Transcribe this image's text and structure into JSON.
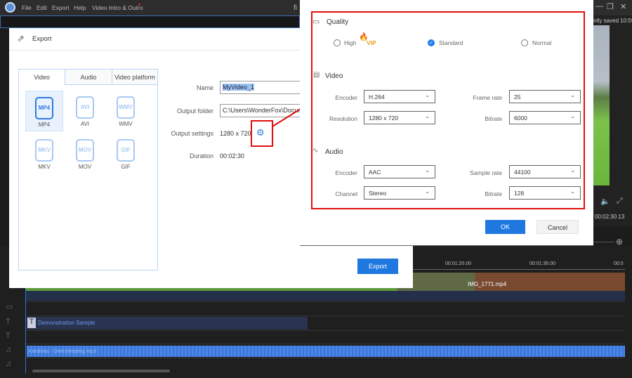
{
  "menu": {
    "items": [
      "File",
      "Edit",
      "Export",
      "Help",
      "Video Intro & Outro"
    ],
    "title_partial": "fi"
  },
  "status": {
    "saved": "ntly saved 10:59",
    "timecode": "00:02:30.13"
  },
  "export": {
    "title": "Export",
    "tabs": [
      "Video",
      "Audio",
      "Video platform"
    ],
    "formats": [
      {
        "icon": "MP4",
        "label": "MP4"
      },
      {
        "icon": "AVI",
        "label": "AVI"
      },
      {
        "icon": "WMV",
        "label": "WMV"
      },
      {
        "icon": "MKV",
        "label": "MKV"
      },
      {
        "icon": "MOV",
        "label": "MOV"
      },
      {
        "icon": "GIF",
        "label": "GIF"
      }
    ],
    "name_label": "Name",
    "name_value": "MyVideo_1",
    "folder_label": "Output folder",
    "folder_value": "C:\\Users\\WonderFox\\Docum",
    "settings_label": "Output settings",
    "settings_value": "1280 x 720",
    "duration_label": "Duration",
    "duration_value": "00:02:30",
    "export_button": "Export"
  },
  "settings": {
    "quality_title": "Quality",
    "quality_options": [
      "High",
      "Standard",
      "Normal"
    ],
    "quality_selected": "Standard",
    "vip_badge": "VIP",
    "video_title": "Video",
    "video": {
      "encoder_label": "Encoder",
      "encoder": "H.264",
      "resolution_label": "Resolution",
      "resolution": "1280 x 720",
      "framerate_label": "Frame rate",
      "framerate": "25",
      "bitrate_label": "Bitrate",
      "bitrate": "6000"
    },
    "audio_title": "Audio",
    "audio": {
      "encoder_label": "Encoder",
      "encoder": "AAC",
      "channel_label": "Channel",
      "channel": "Stereo",
      "samplerate_label": "Sample rate",
      "samplerate": "44100",
      "bitrate_label": "Bitrate",
      "bitrate": "128"
    },
    "ok": "OK",
    "cancel": "Cancel"
  },
  "timeline": {
    "ruler": [
      "00:01:20.00",
      "00:01:36.00",
      "00:0"
    ],
    "video_clip": "IMG_1771.mp4",
    "text_clip": "Demonstration Sample",
    "audio_clip": "Xandrias - Oversleeping.mp3"
  },
  "colors": {
    "accent": "#1e78e0",
    "highlight_box": "#e01010",
    "audio_wave": "#4a86e8"
  }
}
